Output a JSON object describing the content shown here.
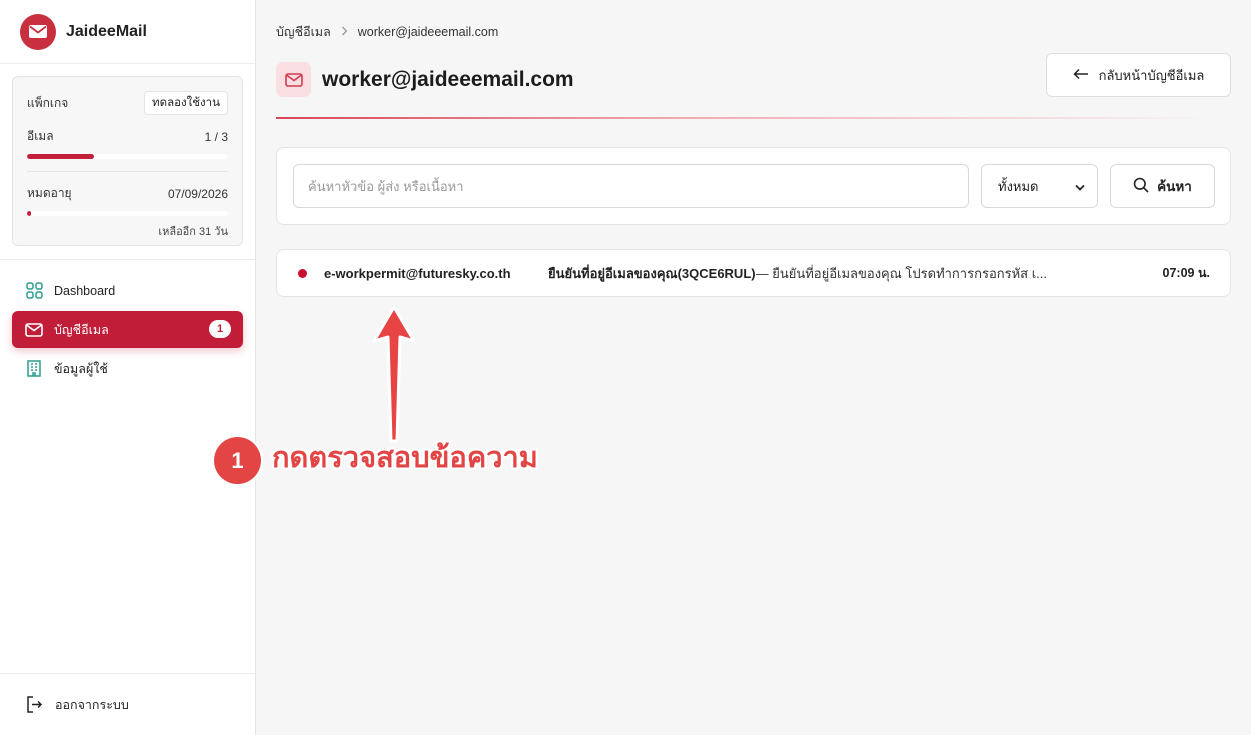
{
  "brand": {
    "name": "JaideeMail",
    "logo_icon": "envelope-logo-icon"
  },
  "package": {
    "label": "แพ็กเกจ",
    "plan_badge": "ทดลองใช้งาน",
    "email_label": "อีเมล",
    "email_usage": "1 / 3",
    "email_usage_fraction": 0.3333,
    "expire_label": "หมดอายุ",
    "expire_date": "07/09/2026",
    "expire_fraction": 0.02,
    "remaining_text": "เหลืออีก 31 วัน"
  },
  "nav": {
    "items": [
      {
        "label": "Dashboard",
        "icon": "grid-icon",
        "active": false
      },
      {
        "label": "บัญชีอีเมล",
        "icon": "mail-icon",
        "active": true,
        "badge": "1"
      },
      {
        "label": "ข้อมูลผู้ใช้",
        "icon": "building-icon",
        "active": false
      }
    ],
    "logout_label": "ออกจากระบบ"
  },
  "breadcrumb": {
    "root": "บัญชีอีเมล",
    "current": "worker@jaideeemail.com"
  },
  "header": {
    "title": "worker@jaideeemail.com",
    "back_label": "กลับหน้าบัญชีอีเมล"
  },
  "search": {
    "placeholder": "ค้นหาหัวข้อ ผู้ส่ง หรือเนื้อหา",
    "value": "",
    "filter_selected": "ทั้งหมด",
    "button_label": "ค้นหา"
  },
  "messages": [
    {
      "from": "e-workpermit@futuresky.co.th",
      "subject": "ยืนยันที่อยู่อีเมลของคุณ(3QCE6RUL)",
      "snippet": " — ยืนยันที่อยู่อีเมลของคุณ โปรดทำการกรอกรหัส เ...",
      "time": "07:09 น.",
      "unread": true
    }
  ],
  "annotation": {
    "step": "1",
    "text": "กดตรวจสอบข้อความ"
  },
  "colors": {
    "accent": "#c21d38",
    "annotation": "#e34545"
  }
}
